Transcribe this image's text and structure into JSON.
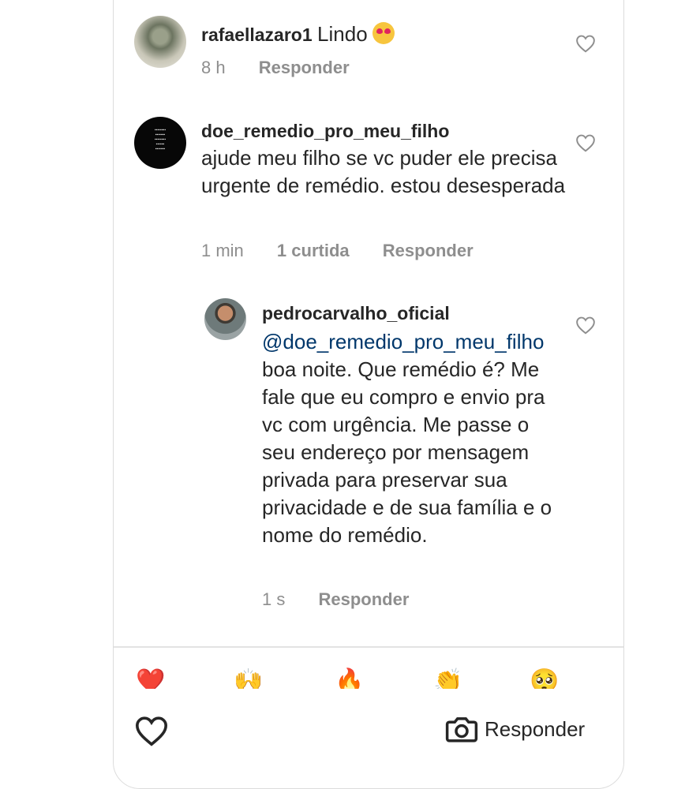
{
  "comments": [
    {
      "username": "rafaellazaro1",
      "text": "Lindo",
      "emoji": "heart-eyes",
      "time": "8 h",
      "reply_label": "Responder"
    },
    {
      "username": "doe_remedio_pro_meu_filho",
      "text": "ajude meu filho se vc puder ele precisa urgente de remédio. estou desesperada",
      "time": "1 min",
      "likes": "1 curtida",
      "reply_label": "Responder"
    }
  ],
  "reply": {
    "username": "pedrocarvalho_oficial",
    "mention": "@doe_remedio_pro_meu_filho",
    "text": " boa noite. Que remédio é? Me fale que eu compro e envio pra vc com urgência. Me passe o seu endereço por mensagem privada para preservar sua privacidade e de sua família e o nome do remédio.",
    "time": "1 s",
    "reply_label": "Responder"
  },
  "reactions": [
    "❤️",
    "🙌",
    "🔥",
    "👏",
    "🥺"
  ],
  "bottom_bar": {
    "reply_label": "Responder"
  },
  "colors": {
    "text": "#262626",
    "meta": "#8e8e8e",
    "mention": "#00376b",
    "border": "#dcdcdc"
  }
}
